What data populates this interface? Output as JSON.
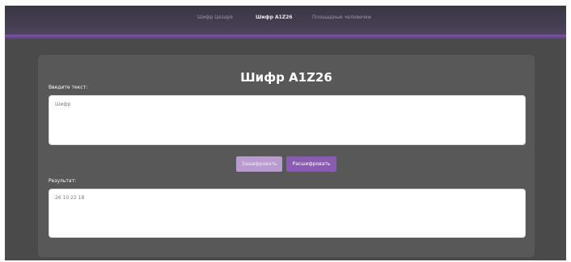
{
  "nav": {
    "items": [
      {
        "label": "Шифр Цезаря",
        "active": false
      },
      {
        "label": "Шифр A1Z26",
        "active": true
      },
      {
        "label": "Площадные человечки",
        "active": false
      }
    ]
  },
  "page": {
    "title": "Шифр A1Z26",
    "input_label": "Введите текст:",
    "input_value": "Шифр",
    "encrypt_label": "Зашифровать",
    "decrypt_label": "Расшифровать",
    "output_label": "Результат:",
    "output_value": "26 10 22 18"
  },
  "colors": {
    "nav_bg": "#443d4f",
    "nav_accent": "#7c57a8",
    "page_bg": "#4a4a4a",
    "card_bg": "#585858",
    "encrypt_button": "#b99bd0",
    "decrypt_button": "#8a5bb2"
  }
}
